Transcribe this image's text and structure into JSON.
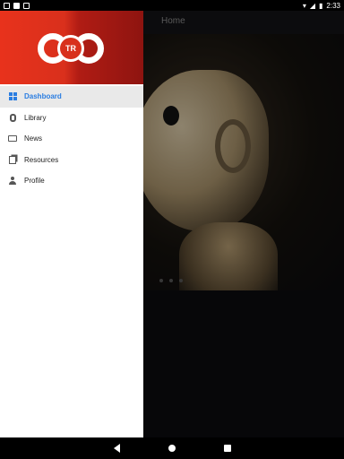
{
  "status_bar": {
    "time": "2:33",
    "icons": [
      "image-icon",
      "sd-card-icon",
      "download-icon",
      "wifi-icon",
      "signal-icon",
      "battery-icon"
    ]
  },
  "app": {
    "title": "Home",
    "carousel": {
      "pages": 3
    }
  },
  "drawer": {
    "logo_text": "TR",
    "items": [
      {
        "label": "Dashboard",
        "icon": "dashboard-grid-icon",
        "active": true
      },
      {
        "label": "Library",
        "icon": "library-stack-icon",
        "active": false
      },
      {
        "label": "News",
        "icon": "news-icon",
        "active": false
      },
      {
        "label": "Resources",
        "icon": "resources-icon",
        "active": false
      },
      {
        "label": "Profile",
        "icon": "person-icon",
        "active": false
      }
    ]
  },
  "colors": {
    "brand_red": "#e8321c",
    "accent_blue": "#2a7de1"
  }
}
